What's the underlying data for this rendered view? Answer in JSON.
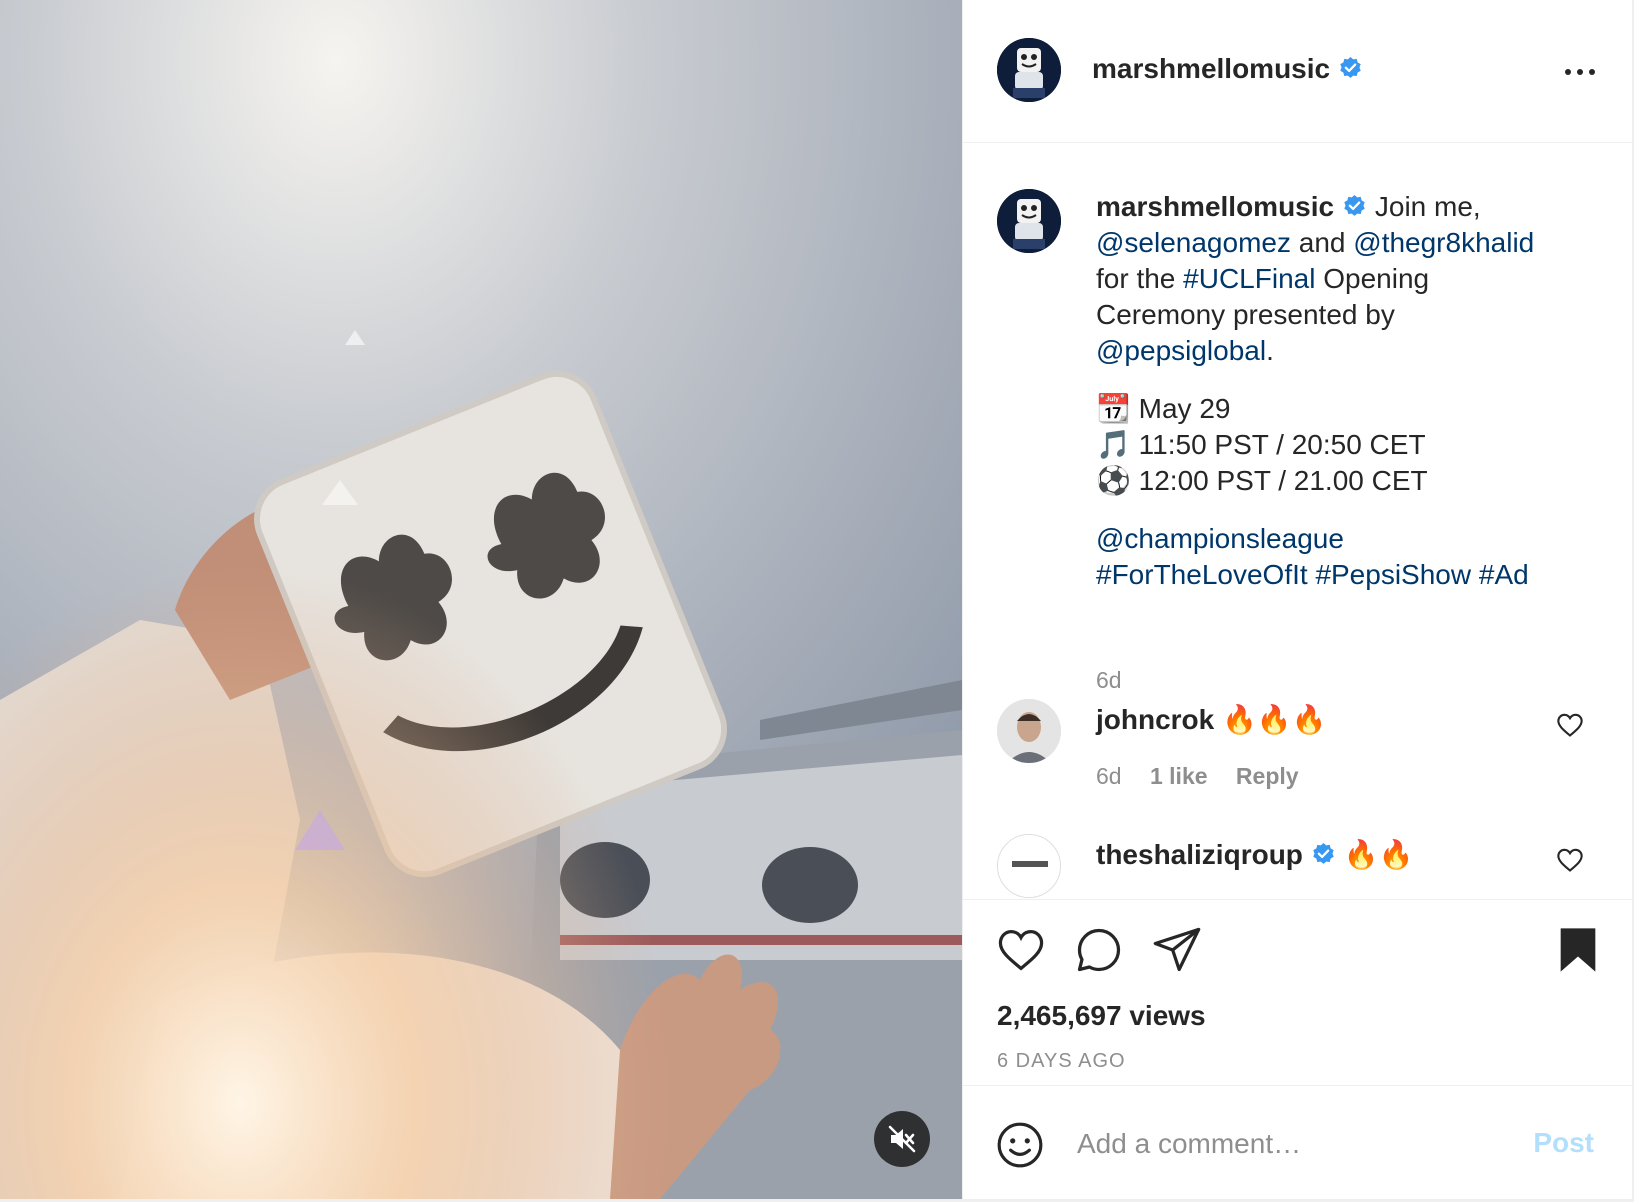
{
  "post": {
    "author": {
      "username": "marshmellomusic",
      "verified": true
    },
    "caption": {
      "lead": "Join me,",
      "mention_1": "@selenagomez",
      "and": "and",
      "mention_2": "@thegr8khalid",
      "for_the": "for the",
      "hashtag_1": "#UCLFinal",
      "rest_1": "Opening",
      "rest_2": "Ceremony presented by",
      "mention_3": "@pepsiglobal",
      "period": ".",
      "schedule": [
        {
          "icon": "calendar-icon",
          "text": "May 29"
        },
        {
          "icon": "music-note-icon",
          "text": "11:50 PST / 20:50 CET"
        },
        {
          "icon": "soccer-ball-icon",
          "text": "12:00 PST / 21.00 CET"
        }
      ],
      "mention_4": "@championsleague",
      "hashtags": [
        "#ForTheLoveOfIt",
        "#PepsiShow",
        "#Ad"
      ],
      "time": "6d"
    },
    "comments": [
      {
        "username": "johncrok",
        "verified": false,
        "text": "🔥🔥🔥",
        "time": "6d",
        "likes": "1 like",
        "reply": "Reply"
      },
      {
        "username": "theshaliziqroup",
        "verified": true,
        "text": "🔥🔥",
        "time": "",
        "likes": "",
        "reply": ""
      }
    ],
    "views": "2,465,697 views",
    "age": "6 DAYS AGO",
    "add_comment_placeholder": "Add a comment…",
    "post_label": "Post"
  },
  "colors": {
    "link": "#00376b",
    "verified": "#3897f0",
    "muted_text": "#8e8e8e",
    "post_button_disabled": "#b2dffc"
  }
}
